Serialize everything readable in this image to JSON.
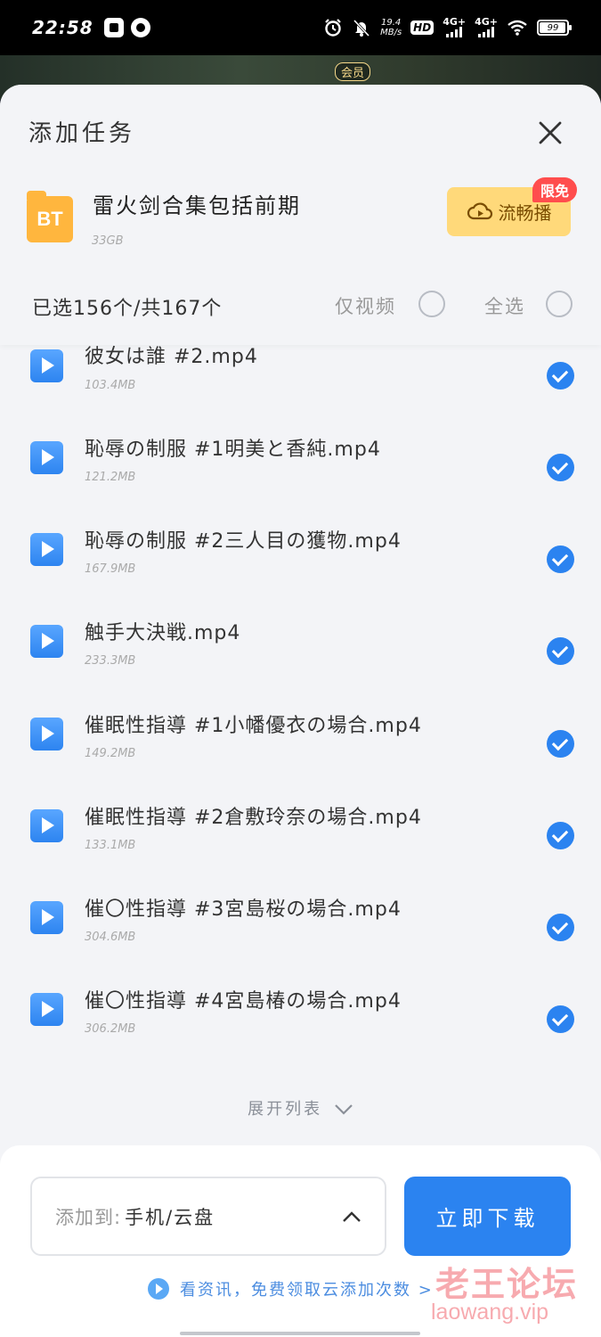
{
  "status_bar": {
    "time": "22:58",
    "net_speed": "19.4",
    "net_speed_unit": "MB/s",
    "hd_label": "HD",
    "network1": "4G+",
    "network2": "4G+",
    "battery": "99",
    "icons": [
      "app-icon",
      "browser-icon",
      "alarm-icon",
      "mute-icon",
      "signal-icon",
      "wifi-icon",
      "battery-icon"
    ]
  },
  "background": {
    "vip_badge": "会员"
  },
  "dialog": {
    "title": "添加任务",
    "close_icon": "close-icon",
    "file": {
      "type_label": "BT",
      "name": "雷火剑合集包括前期",
      "size": "33GB"
    },
    "stream_button": {
      "label": "流畅播",
      "badge": "限免"
    },
    "selection": {
      "count": "已选156个/共167个",
      "video_only_label": "仅视频",
      "select_all_label": "全选"
    },
    "files": [
      {
        "name": "彼女は誰 #2.mp4",
        "size": "103.4MB",
        "checked": true
      },
      {
        "name": "恥辱の制服 #1明美と香純.mp4",
        "size": "121.2MB",
        "checked": true
      },
      {
        "name": "恥辱の制服 #2三人目の獲物.mp4",
        "size": "167.9MB",
        "checked": true
      },
      {
        "name": "触手大決戦.mp4",
        "size": "233.3MB",
        "checked": true
      },
      {
        "name": "催眠性指導 #1小幡優衣の場合.mp4",
        "size": "149.2MB",
        "checked": true
      },
      {
        "name": "催眠性指導 #2倉敷玲奈の場合.mp4",
        "size": "133.1MB",
        "checked": true
      },
      {
        "name": "催〇性指導 #3宮島桜の場合.mp4",
        "size": "304.6MB",
        "checked": true
      },
      {
        "name": "催〇性指導 #4宮島椿の場合.mp4",
        "size": "306.2MB",
        "checked": true
      }
    ],
    "expand_label": "展开列表",
    "footer": {
      "dest_prefix": "添加到:",
      "dest_value": "手机/云盘",
      "download_button": "立即下载",
      "promo_text": "看资讯，免费领取云添加次数 >"
    }
  },
  "watermark": {
    "line1": "老王论坛",
    "line2": "laowang.vip"
  },
  "colors": {
    "accent": "#2b83f0",
    "stream_bg": "#ffd97a",
    "badge_red": "#ff4d4d",
    "folder": "#ffb63e"
  }
}
